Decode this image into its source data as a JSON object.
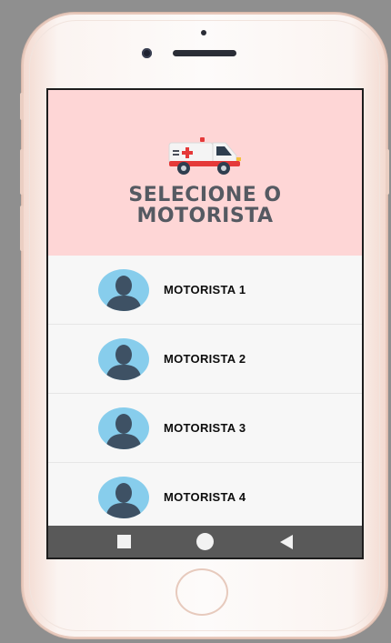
{
  "header": {
    "icon": "ambulance-icon",
    "title_line1": "SELECIONE O",
    "title_line2": "MOTORISTA",
    "background": "#fed6d6"
  },
  "drivers": [
    {
      "label": "MOTORISTA 1",
      "avatar": "user-avatar-icon"
    },
    {
      "label": "MOTORISTA 2",
      "avatar": "user-avatar-icon"
    },
    {
      "label": "MOTORISTA 3",
      "avatar": "user-avatar-icon"
    },
    {
      "label": "MOTORISTA 4",
      "avatar": "user-avatar-icon"
    }
  ],
  "navbar": {
    "buttons": [
      "recent-apps-icon",
      "home-icon",
      "back-icon"
    ],
    "background": "#595959"
  },
  "colors": {
    "avatar_bg": "#87cdec",
    "avatar_person": "#3e5164"
  }
}
